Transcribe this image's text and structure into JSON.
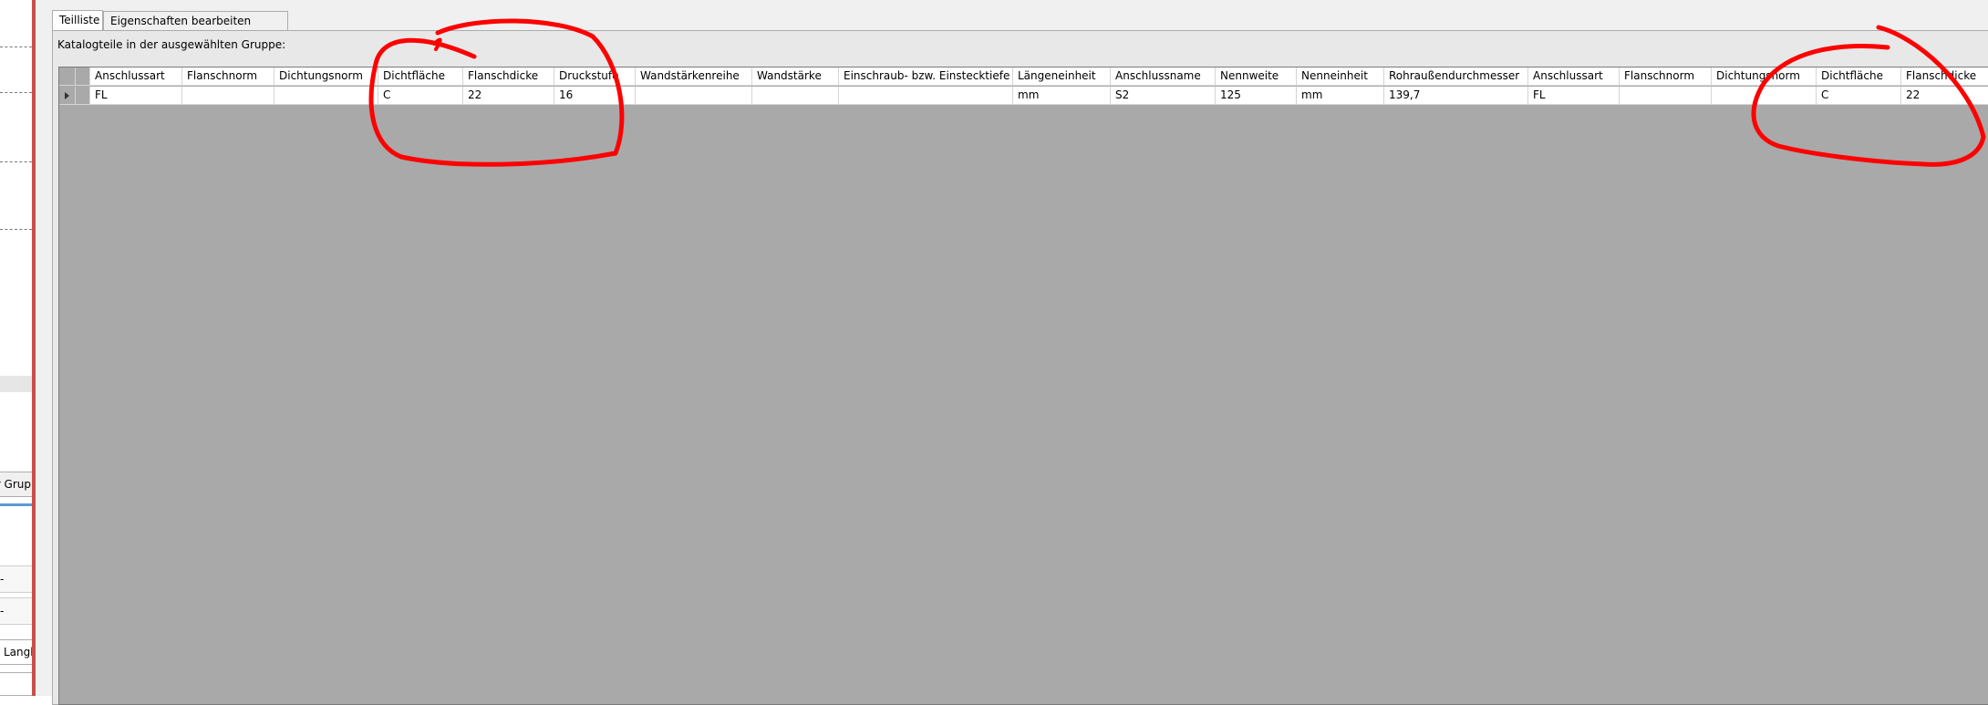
{
  "left_panel": {
    "group_button_label": "ur Grup",
    "field_label": "Langb"
  },
  "tabs": [
    {
      "label": "Teilliste",
      "active": true
    },
    {
      "label": "Eigenschaften bearbeiten",
      "active": false
    }
  ],
  "group_label": "Katalogteile in der ausgewählten Gruppe:",
  "grid": {
    "columns": [
      "Anschlussart",
      "Flanschnorm",
      "Dichtungsnorm",
      "Dichtfläche",
      "Flanschdicke",
      "Druckstufe",
      "Wandstärkenreihe",
      "Wandstärke",
      "Einschraub- bzw. Einstecktiefe",
      "Längeneinheit",
      "Anschlussname",
      "Nennweite",
      "Nenneinheit",
      "Rohraußendurchmesser",
      "Anschlussart",
      "Flanschnorm",
      "Dichtungsnorm",
      "Dichtfläche",
      "Flanschdicke"
    ],
    "rows": [
      [
        "FL",
        "",
        "",
        "C",
        "22",
        "16",
        "",
        "",
        "",
        "mm",
        "S2",
        "125",
        "mm",
        "139,7",
        "FL",
        "",
        "",
        "C",
        "22"
      ]
    ]
  },
  "colors": {
    "annotation": "#ff0000",
    "grid_background": "#a9a9a9",
    "window_border": "#c8504a"
  }
}
